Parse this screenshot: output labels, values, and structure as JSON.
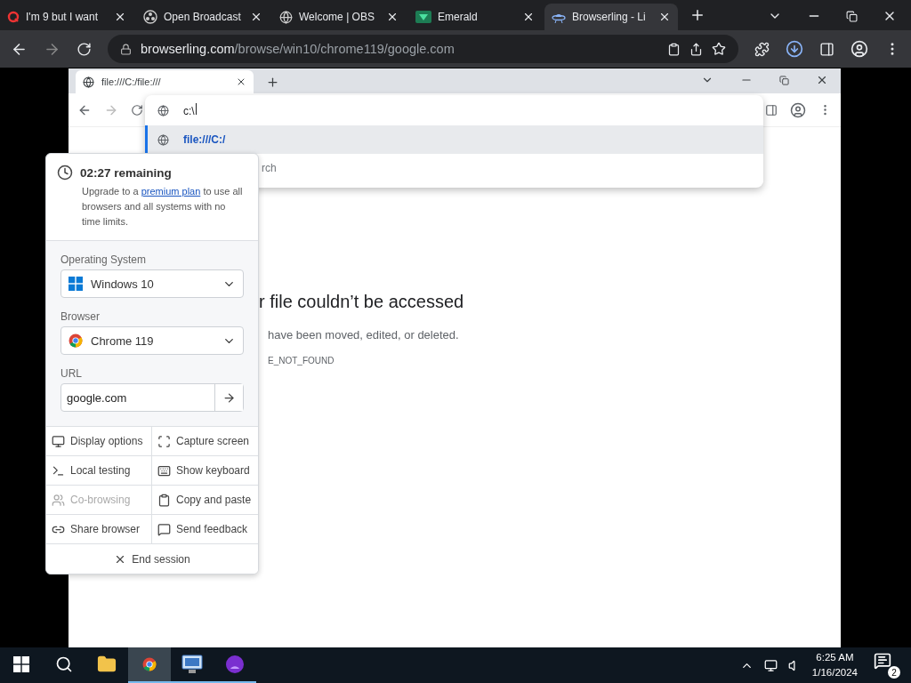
{
  "browser": {
    "tabs": [
      {
        "title": "I'm 9 but I want",
        "selected": false
      },
      {
        "title": "Open Broadcast",
        "selected": false
      },
      {
        "title": "Welcome | OBS",
        "selected": false
      },
      {
        "title": "Emerald",
        "selected": false
      },
      {
        "title": "Browserling - Li",
        "selected": true
      }
    ],
    "address": "browserling.com/browse/win10/chrome119/google.com"
  },
  "remote_browser": {
    "tab": {
      "title": "file:///C:/file:///",
      "selected": true
    },
    "omnibox": {
      "value": "c:\\",
      "suggestions": [
        {
          "text": "file:///C:/",
          "selected": true
        },
        {
          "text": "rch",
          "selected": false
        }
      ]
    },
    "error": {
      "title": "r file couldn’t be accessed",
      "message": "have been moved, edited, or deleted.",
      "code": "E_NOT_FOUND"
    }
  },
  "session_panel": {
    "timer": "02:27 remaining",
    "upgrade": {
      "before": "Upgrade to a",
      "link": "premium plan",
      "after": "to use all browsers and all systems with no time limits."
    },
    "os": {
      "label": "Operating System",
      "value": "Windows 10"
    },
    "browser": {
      "label": "Browser",
      "value": "Chrome 119"
    },
    "url": {
      "label": "URL",
      "value": "google.com"
    },
    "actions": [
      {
        "label": "Display options",
        "disabled": false
      },
      {
        "label": "Capture screen",
        "disabled": false
      },
      {
        "label": "Local testing",
        "disabled": false
      },
      {
        "label": "Show keyboard",
        "disabled": false
      },
      {
        "label": "Co-browsing",
        "disabled": true
      },
      {
        "label": "Copy and paste",
        "disabled": false
      },
      {
        "label": "Share browser",
        "disabled": false
      },
      {
        "label": "Send feedback",
        "disabled": false
      }
    ],
    "end_session": "End session"
  },
  "taskbar": {
    "apps": [
      {
        "selected": false
      },
      {
        "selected": true
      },
      {
        "selected": false
      },
      {
        "selected": false
      }
    ],
    "time": "6:25 AM",
    "date": "1/16/2024",
    "notifications": "2"
  }
}
